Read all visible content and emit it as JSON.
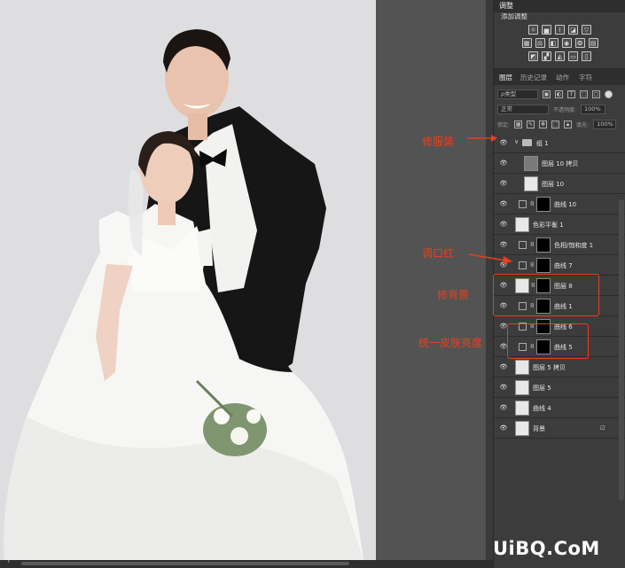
{
  "adjustments_panel": {
    "tab": "调整",
    "title": "添加调整"
  },
  "layers_panel": {
    "tabs": [
      "图层",
      "历史记录",
      "动作",
      "字符"
    ],
    "filter_kind": "ρ类型",
    "blend_mode": "正常",
    "opacity_label": "不透明度:",
    "opacity_value": "100%",
    "lock_label": "锁定:",
    "fill_label": "填充:",
    "fill_value": "100%",
    "layers": [
      {
        "name": "组 1",
        "kind": "group"
      },
      {
        "name": "图层 10 拷贝",
        "kind": "pixel"
      },
      {
        "name": "图层 10",
        "kind": "pixel"
      },
      {
        "name": "曲线 10",
        "kind": "adjustment"
      },
      {
        "name": "色彩平衡 1",
        "kind": "adjustment"
      },
      {
        "name": "色相/饱和度 1",
        "kind": "adjustment"
      },
      {
        "name": "曲线 7",
        "kind": "adjustment"
      },
      {
        "name": "图层 8",
        "kind": "pixel-mask"
      },
      {
        "name": "曲线 1",
        "kind": "adjustment"
      },
      {
        "name": "曲线 6",
        "kind": "adjustment"
      },
      {
        "name": "曲线 5",
        "kind": "adjustment"
      },
      {
        "name": "图层 5 拷贝",
        "kind": "pixel"
      },
      {
        "name": "图层 5",
        "kind": "pixel"
      },
      {
        "name": "曲线 4",
        "kind": "pixel"
      },
      {
        "name": "背景",
        "kind": "background"
      }
    ]
  },
  "annotations": {
    "clothes": "修服装",
    "lips": "调口红",
    "background": "修背景",
    "skin": "统一皮肤亮度"
  },
  "watermark": "UiBQ.CoM",
  "colors": {
    "annotation": "#e8401e",
    "panel_bg": "#3c3c3c",
    "canvas_bg": "#535353"
  }
}
